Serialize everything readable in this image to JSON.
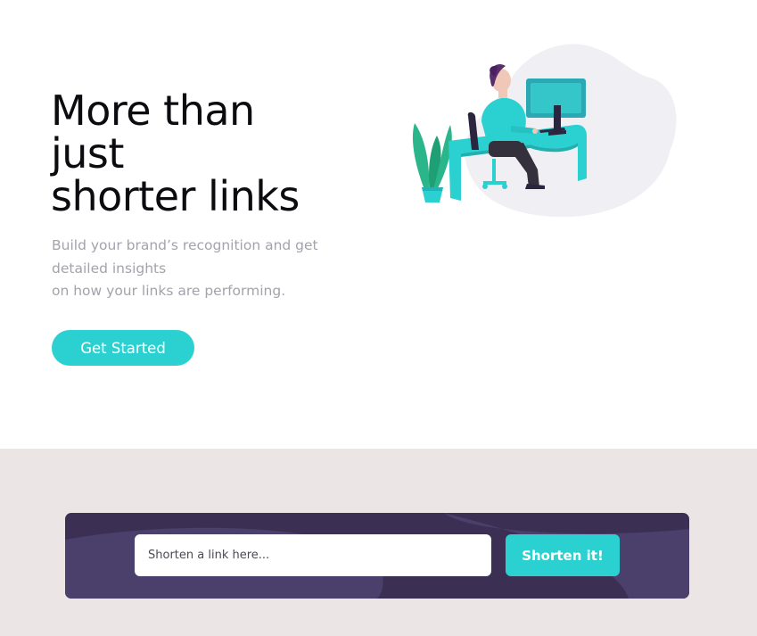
{
  "hero": {
    "title_lines": [
      "More than",
      "just",
      "shorter links"
    ],
    "subtitle_lines": [
      "Build your brand’s recognition and get",
      "detailed insights",
      "on how your links are performing."
    ],
    "cta_label": "Get Started",
    "illustration": "person-working-at-desk-illustration"
  },
  "shorten": {
    "placeholder": "Shorten a link here...",
    "value": "",
    "button_label": "Shorten it!"
  },
  "colors": {
    "accent": "#2bd0d0",
    "title": "#0b0b10",
    "muted_text": "#a4a2ab",
    "shorten_bar_bg": "#3b3054",
    "section_bg": "#ebe5e5"
  }
}
